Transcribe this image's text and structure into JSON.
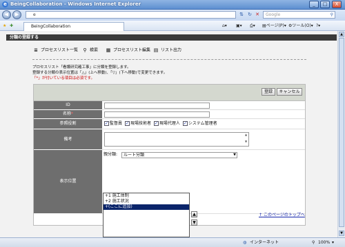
{
  "window": {
    "title": "BeingCollaboration - Windows Internet Explorer",
    "ie_logo": "e",
    "min": "_",
    "max": "□",
    "close": "X"
  },
  "address": {
    "url": "e",
    "search_placeholder": "Google"
  },
  "tab": {
    "label": "BeingCollaboration"
  },
  "toolbar": {
    "page_label": "ページ(P)",
    "tools_label": "ツール(O)"
  },
  "page": {
    "title": "分類の登録する",
    "menu": [
      {
        "label": "プロセスリスト一覧",
        "icon": "list-icon"
      },
      {
        "label": "検索",
        "icon": "search-icon"
      },
      {
        "label": "プロセスリスト編集",
        "icon": "edit-icon"
      },
      {
        "label": "リスト出力",
        "icon": "export-icon"
      }
    ],
    "info_lines": [
      "プロセスリスト「看護研究確工事」に分類を登録します。",
      "登録する分類の表示位置は「△」(上へ移動)、「▽」(下へ移動)で変更できます。",
      "「*」が付いている項目は必須です。"
    ]
  },
  "form": {
    "register_button": "登録",
    "cancel_button": "キャンセル",
    "fields": {
      "id": "ID",
      "name": "名称",
      "roles": "参照役割",
      "notes": "備考",
      "position": "表示位置"
    },
    "required_mark": "*",
    "roles": [
      {
        "label": "監督員",
        "checked": true
      },
      {
        "label": "現場技術者",
        "checked": true
      },
      {
        "label": "現場代理人",
        "checked": true
      },
      {
        "label": "システム管理者",
        "checked": true
      }
    ],
    "parent_label": "親分類:",
    "parent_value": "ルート分類",
    "list_items": [
      {
        "label": "+1 施工体制",
        "selected": false
      },
      {
        "label": "+2 施工状況",
        "selected": false
      },
      {
        "label": "+(ここに追加)",
        "selected": true
      }
    ],
    "up_arrow": "▲",
    "down_arrow": "▼"
  },
  "footer": {
    "top_link": "このページのトップへ"
  },
  "status": {
    "zone": "インターネット",
    "zoom": "100%"
  }
}
